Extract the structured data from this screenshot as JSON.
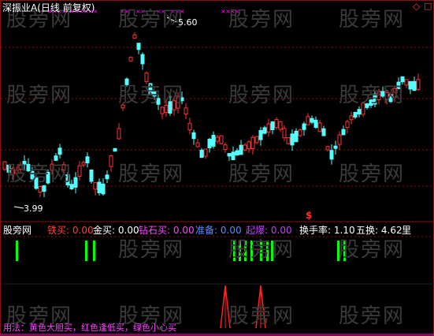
{
  "title": "深振业A(日线 前复权)",
  "colors": {
    "up": "#ff3232",
    "down": "#54ffff",
    "grid": "#8a1010",
    "title": "#ffffff",
    "signal_green": "#00ff00",
    "signal_red": "#ff2020",
    "purple": "#ff00ff"
  },
  "top_icons": [
    "diamond-icon",
    "square-icon"
  ],
  "price_annotations": {
    "high": "5.60",
    "low": "3.99",
    "marker": "$"
  },
  "watermark": "股旁网",
  "indicator_bar": {
    "label": "股旁网",
    "items": [
      {
        "label": "铁买:",
        "value": "0.00",
        "color": "#ff3c3c"
      },
      {
        "label": "金买:",
        "value": "0.00",
        "color": "#ffffff"
      },
      {
        "label": "钻石买:",
        "value": "0.00",
        "color": "#ff44ff"
      },
      {
        "label": "准备:",
        "value": "0.00",
        "color": "#5a8cff"
      },
      {
        "label": "起爆:",
        "value": "0.00",
        "color": "#c040ff"
      }
    ],
    "turnover": {
      "label": "换手率:",
      "value": "1.10"
    },
    "five_turnover": {
      "label": "五换:",
      "value": "4.62"
    },
    "unit": "里"
  },
  "usage_note": "用法：黄色大胆买，红色逢低买，绿色小心买"
}
